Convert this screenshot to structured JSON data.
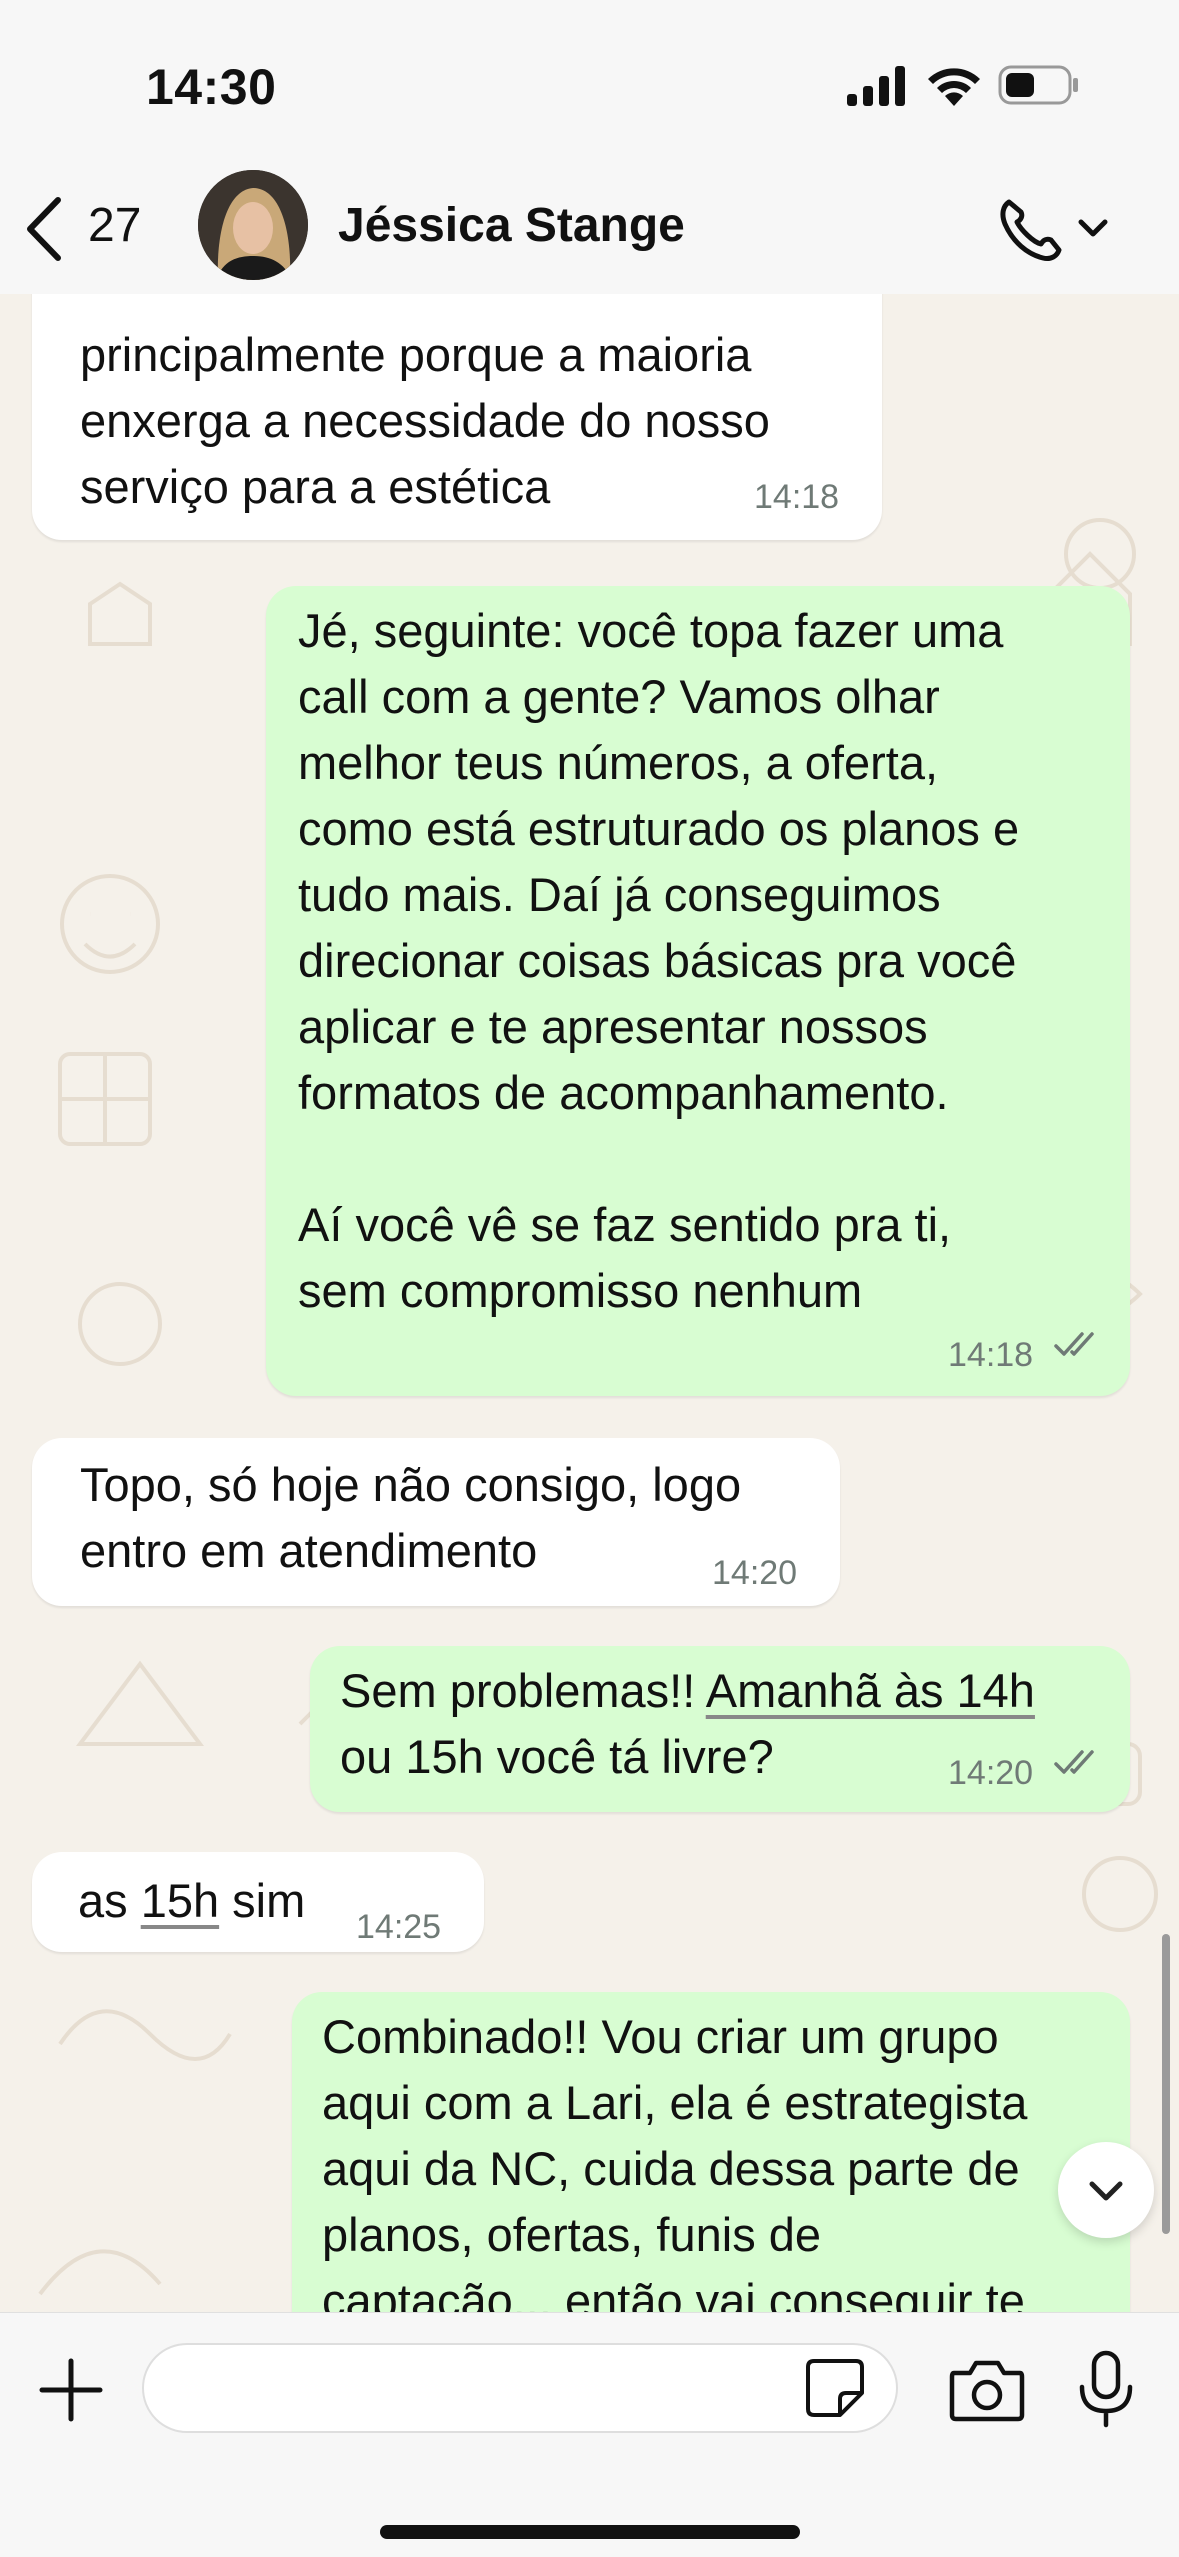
{
  "status": {
    "time": "14:30"
  },
  "header": {
    "back_count": "27",
    "contact_name": "Jéssica Stange"
  },
  "messages": [
    {
      "direction": "in",
      "text": "principalmente porque a maioria\nenxerga a necessidade do nosso\nserviço para a estética",
      "time": "14:18"
    },
    {
      "direction": "out",
      "text": "Jé, seguinte: você topa fazer uma\ncall com a gente? Vamos olhar\nmelhor teus números, a oferta,\ncomo está estruturado os planos e\ntudo mais. Daí já conseguimos\ndirecionar coisas básicas pra você\naplicar e te apresentar nossos\nformatos de acompanhamento.\n\nAí você vê se faz sentido pra ti,\nsem compromisso nenhum",
      "time": "14:18",
      "status": "read"
    },
    {
      "direction": "in",
      "text": "Topo, só hoje não consigo, logo\nentro em atendimento",
      "time": "14:20"
    },
    {
      "direction": "out",
      "text_before": "Sem problemas!! ",
      "text_link": "Amanhã às 14h",
      "text_after": "\nou 15h você tá livre?",
      "time": "14:20",
      "status": "read"
    },
    {
      "direction": "in",
      "text_before": "as ",
      "text_link": "15h",
      "text_after": " sim",
      "time": "14:25"
    },
    {
      "direction": "out",
      "text": "Combinado!! Vou criar um grupo\naqui com a Lari, ela é estrategista\naqui da NC, cuida dessa parte de\nplanos, ofertas, funis de\ncaptação... então vai conseguir te",
      "time": ""
    }
  ],
  "icons": {
    "back": "chevron-left-icon",
    "call": "phone-icon",
    "plus": "plus-icon",
    "sticker": "sticker-icon",
    "camera": "camera-icon",
    "mic": "microphone-icon",
    "scroll_down": "chevron-down-icon"
  },
  "colors": {
    "incoming": "#ffffff",
    "outgoing": "#d8fdd2",
    "background": "#f5f1ea"
  }
}
